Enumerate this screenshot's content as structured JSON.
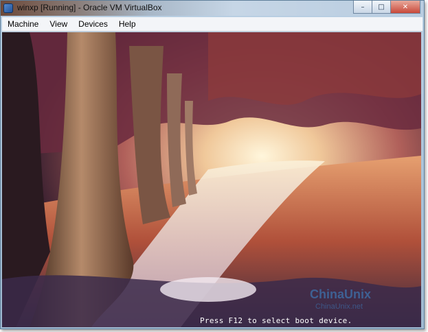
{
  "window": {
    "title": "winxp [Running] - Oracle VM VirtualBox",
    "minimize_glyph": "–",
    "maximize_glyph": "□",
    "close_glyph": "✕"
  },
  "menu": {
    "items": [
      {
        "label": "Machine"
      },
      {
        "label": "View"
      },
      {
        "label": "Devices"
      },
      {
        "label": "Help"
      }
    ]
  },
  "vm_screen": {
    "boot_message": "Press F12 to select boot device.",
    "wallpaper": "autumn tree-lined forest path"
  },
  "watermark": {
    "text": "ChinaUnix",
    "subtext": "ChinaUnix.net"
  },
  "icons": {
    "app": "virtualbox-icon",
    "minimize": "minimize-icon",
    "maximize": "maximize-icon",
    "close": "close-icon"
  },
  "colors": {
    "titlebar_start": "#6d4a3a",
    "titlebar_end": "#b8cce0",
    "menubar": "#f3f5f8",
    "close_button": "#c8493a",
    "boot_text": "#ffffff"
  }
}
